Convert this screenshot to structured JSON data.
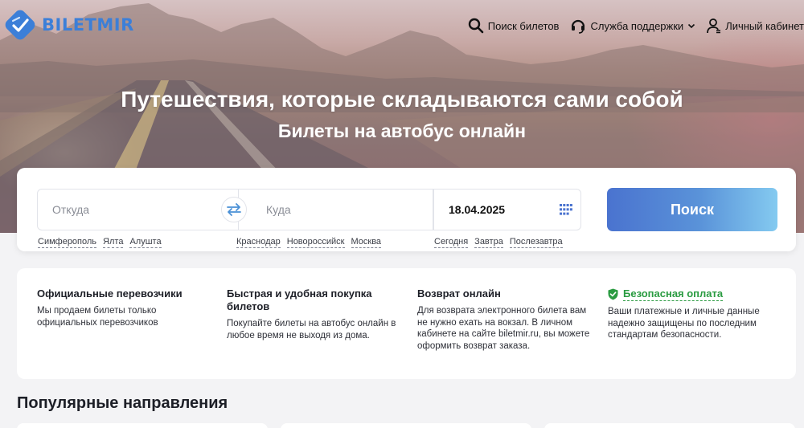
{
  "brand": {
    "name": "BILETMIR",
    "color": "#3c7fd8"
  },
  "nav": {
    "search": {
      "label": "Поиск билетов",
      "icon": "search-icon"
    },
    "support": {
      "label": "Служба поддержки",
      "icon": "headset-icon"
    },
    "account": {
      "label": "Личный кабинет",
      "icon": "user-icon"
    }
  },
  "hero": {
    "title": "Путешествия, которые складываются сами собой",
    "subtitle": "Билеты на автобус онлайн"
  },
  "search": {
    "from_placeholder": "Откуда",
    "to_placeholder": "Куда",
    "date_value": "18.04.2025",
    "button_label": "Поиск",
    "from_suggestions": [
      "Симферополь",
      "Ялта",
      "Алушта"
    ],
    "to_suggestions": [
      "Краснодар",
      "Новороссийск",
      "Москва"
    ],
    "date_suggestions": [
      "Сегодня",
      "Завтра",
      "Послезавтра"
    ],
    "accent": "#4a73cf"
  },
  "features": [
    {
      "title": "Официальные перевозчики",
      "text": "Мы продаем билеты только официальных перевозчиков"
    },
    {
      "title": "Быстрая и удобная покупка билетов",
      "text": "Покупайте билеты на автобус онлайн в любое время не выходя из дома."
    },
    {
      "title": "Возврат онлайн",
      "text": "Для возврата электронного билета вам не нужно ехать на вокзал. В личном кабинете на сайте biletmir.ru, вы можете оформить возврат заказа."
    },
    {
      "title": "Безопасная оплата",
      "text": "Ваши платежные и личные данные надежно защищены по последним стандартам безопасности.",
      "icon": "shield-check-icon",
      "color": "#2a9b41"
    }
  ],
  "popular": {
    "title": "Популярные направления"
  }
}
